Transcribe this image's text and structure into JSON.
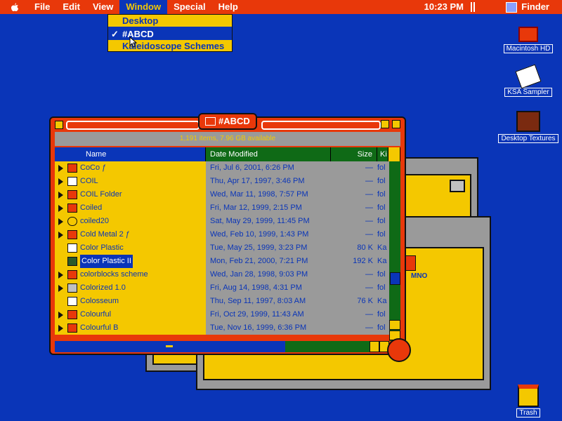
{
  "menubar": {
    "items": [
      "File",
      "Edit",
      "View",
      "Window",
      "Special",
      "Help"
    ],
    "clock": "10:23 PM",
    "app": "Finder"
  },
  "window_menu": {
    "items": [
      "Desktop",
      "#ABCD",
      "Kaleidoscope Schemes"
    ]
  },
  "desktop": {
    "icons": [
      "Macintosh HD",
      "KSA Sampler",
      "Desktop Textures",
      "Trash"
    ]
  },
  "finder_window": {
    "title": "#ABCD",
    "info": "1,191 items, 7.96 GB available",
    "columns": {
      "name": "Name",
      "date": "Date Modified",
      "size": "Size",
      "kind": "Ki"
    },
    "rows": [
      {
        "name": "CoCo ƒ",
        "date": "Fri, Jul 6, 2001, 6:26 PM",
        "size": "—",
        "kind": "fol",
        "icon": "folder",
        "expandable": true
      },
      {
        "name": "COIL",
        "date": "Thu, Apr 17, 1997, 3:46 PM",
        "size": "—",
        "kind": "fol",
        "icon": "doc",
        "expandable": true
      },
      {
        "name": "COIL Folder",
        "date": "Wed, Mar 11, 1998, 7:57 PM",
        "size": "—",
        "kind": "fol",
        "icon": "folder",
        "expandable": true
      },
      {
        "name": "Coiled",
        "date": "Fri, Mar 12, 1999, 2:15 PM",
        "size": "—",
        "kind": "fol",
        "icon": "folder",
        "expandable": true
      },
      {
        "name": "coiled20",
        "date": "Sat, May 29, 1999, 11:45 PM",
        "size": "—",
        "kind": "fol",
        "icon": "round",
        "expandable": true
      },
      {
        "name": "Cold Metal 2 ƒ",
        "date": "Wed, Feb 10, 1999, 1:43 PM",
        "size": "—",
        "kind": "fol",
        "icon": "folder",
        "expandable": true
      },
      {
        "name": "Color Plastic",
        "date": "Tue, May 25, 1999, 3:23 PM",
        "size": "80 K",
        "kind": "Ka",
        "icon": "doc",
        "expandable": false
      },
      {
        "name": "Color Plastic II",
        "date": "Mon, Feb 21, 2000, 7:21 PM",
        "size": "192 K",
        "kind": "Ka",
        "icon": "sel",
        "expandable": false,
        "selected": true
      },
      {
        "name": "colorblocks scheme",
        "date": "Wed, Jan 28, 1998, 9:03 PM",
        "size": "—",
        "kind": "fol",
        "icon": "folder",
        "expandable": true
      },
      {
        "name": "Colorized 1.0",
        "date": "Fri, Aug 14, 1998, 4:31 PM",
        "size": "—",
        "kind": "fol",
        "icon": "app",
        "expandable": true
      },
      {
        "name": "Colosseum",
        "date": "Thu, Sep 11, 1997, 8:03 AM",
        "size": "76 K",
        "kind": "Ka",
        "icon": "doc",
        "expandable": false
      },
      {
        "name": "Colourful",
        "date": "Fri, Oct 29, 1999, 11:43 AM",
        "size": "—",
        "kind": "fol",
        "icon": "folder",
        "expandable": true
      },
      {
        "name": "Colourful B",
        "date": "Tue, Nov 16, 1999, 6:36 PM",
        "size": "—",
        "kind": "fol",
        "icon": "folder",
        "expandable": true
      }
    ]
  },
  "background_window": {
    "text": "MNO"
  },
  "colors": {
    "desktop": "#0a35b8",
    "accent": "#e8380a",
    "yellow": "#f4c800",
    "gray": "#9a9a9a",
    "green": "#0f6a16"
  }
}
